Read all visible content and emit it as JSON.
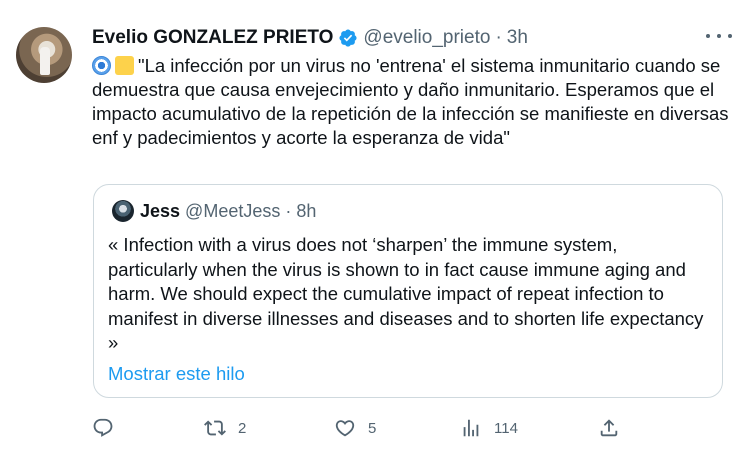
{
  "tweet": {
    "author_name": "Evelio GONZALEZ PRIETO",
    "author_handle": "@evelio_prieto",
    "separator": "·",
    "time": "3h",
    "text": "\"La infección por un virus no 'entrena' el sistema inmunitario cuando se demuestra que causa envejecimiento y daño inmunitario. Esperamos que el impacto acumulativo de la repetición de la infección se manifieste en diversas enf y padecimientos y acorte la esperanza de vida\"",
    "emojis": [
      "blue-circle-emoji",
      "yellow-square-emoji"
    ]
  },
  "quote": {
    "author_name": "Jess",
    "author_handle": "@MeetJess",
    "separator": "·",
    "time": "8h",
    "text": "« Infection with a virus does not ‘sharpen’ the immune system, particularly when the virus is shown to in fact cause immune aging and harm. We should expect the cumulative impact of repeat infection to manifest in diverse illnesses and diseases and to shorten life expectancy »",
    "show_thread_label": "Mostrar este hilo"
  },
  "actions": {
    "reply_count": "",
    "retweet_count": "2",
    "like_count": "5",
    "views_count": "114"
  },
  "colors": {
    "text": "#0f1419",
    "secondary": "#536471",
    "link": "#1d9bf0",
    "border": "#cfd9de"
  }
}
